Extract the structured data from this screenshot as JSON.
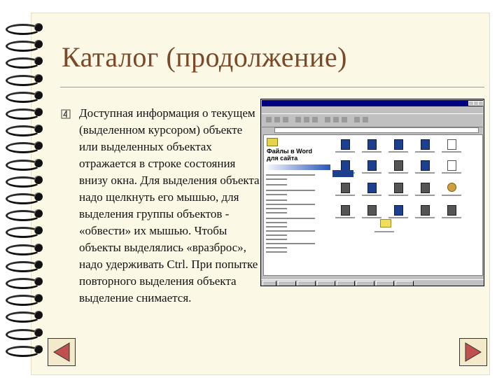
{
  "slide": {
    "title": "Каталог (продолжение)",
    "bullet_icon": "numbered-bullet-icon",
    "body": "Доступная информация о текущем (выделенном курсором) объекте или выделенных объектах отражается в строке состояния внизу окна. Для выделения объекта надо щелкнуть его мышью, для выделения группы объектов - «обвести» их мышью. Чтобы объекты выделялись «вразброс», надо удерживать Ctrl. При попытке повторного выделения объекта выделение снимается."
  },
  "screenshot": {
    "panel_heading_line1": "Файлы в Word",
    "panel_heading_line2": "для сайта"
  },
  "navigation": {
    "prev_icon": "triangle-left-icon",
    "next_icon": "triangle-right-icon"
  },
  "colors": {
    "title": "#7a4a28",
    "paper": "#fcf8e6",
    "nav_arrow": "#c0504d",
    "window_title": "#000080",
    "file_icon": "#1c3f8e"
  }
}
